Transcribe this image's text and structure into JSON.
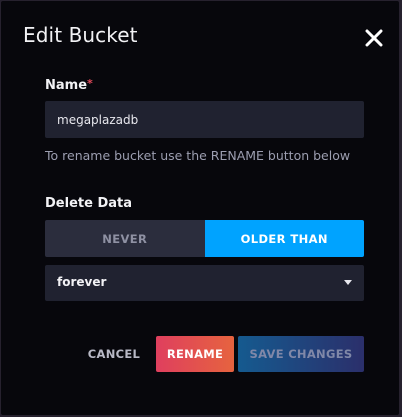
{
  "dialog": {
    "title": "Edit Bucket",
    "close_icon": "close-icon"
  },
  "name_field": {
    "label": "Name",
    "required_marker": "*",
    "value": "megaplazadb",
    "helper_text": "To rename bucket use the RENAME button below"
  },
  "delete_data": {
    "label": "Delete Data",
    "options": [
      "NEVER",
      "OLDER THAN"
    ],
    "selected": "OLDER THAN",
    "duration": {
      "selected_value": "forever",
      "caret_icon": "caret-down-icon"
    }
  },
  "footer": {
    "cancel_label": "CANCEL",
    "rename_label": "RENAME",
    "save_label": "SAVE CHANGES"
  },
  "colors": {
    "backdrop": "#26212e",
    "dialog_background": "#07070c",
    "input_background": "#202230",
    "toggle_inactive": "#2b2d3d",
    "toggle_active": "#00a3ff",
    "required_marker": "#e14a5a",
    "rename_gradient": [
      "#df3f5e",
      "#e6633f"
    ],
    "save_gradient": [
      "#155a8f",
      "#2b2f6b"
    ]
  }
}
